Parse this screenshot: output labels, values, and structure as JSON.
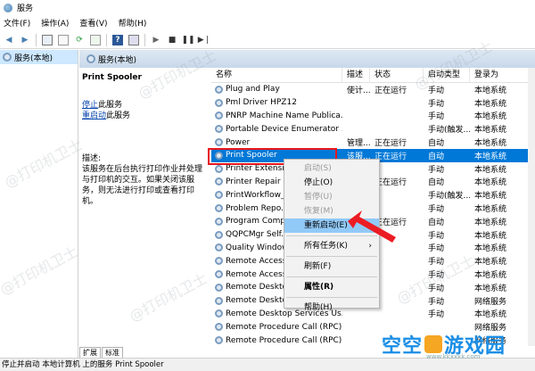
{
  "window": {
    "title": "服务"
  },
  "menu": [
    "文件(F)",
    "操作(A)",
    "查看(V)",
    "帮助(H)"
  ],
  "tree": {
    "root_label": "服务(本地)"
  },
  "pane": {
    "header": "服务(本地)"
  },
  "detail": {
    "service_name": "Print Spooler",
    "stop_link": "停止",
    "stop_suffix": "此服务",
    "restart_link": "重启动",
    "restart_suffix": "此服务",
    "description_label": "描述:",
    "description": "该服务在后台执行打印作业并处理与打印机的交互。如果关闭该服务，则无法进行打印或查看打印机。"
  },
  "columns": [
    "名称",
    "描述",
    "状态",
    "启动类型",
    "登录为"
  ],
  "rows": [
    {
      "name": "Plug and Play",
      "desc": "使计...",
      "status": "正在运行",
      "startup": "手动",
      "logon": "本地系统"
    },
    {
      "name": "Pml Driver HPZ12",
      "desc": "",
      "status": "",
      "startup": "手动",
      "logon": "本地系统"
    },
    {
      "name": "PNRP Machine Name Publica...",
      "desc": "",
      "status": "",
      "startup": "手动",
      "logon": "本地系统"
    },
    {
      "name": "Portable Device Enumerator ...",
      "desc": "",
      "status": "",
      "startup": "手动(触发...",
      "logon": "本地系统"
    },
    {
      "name": "Power",
      "desc": "管理...",
      "status": "正在运行",
      "startup": "自动",
      "logon": "本地系统"
    },
    {
      "name": "Print Spooler",
      "desc": "该服...",
      "status": "正在运行",
      "startup": "自动",
      "logon": "本地系统",
      "selected": true
    },
    {
      "name": "Printer Extensio...",
      "desc": "",
      "status": "",
      "startup": "手动",
      "logon": "本地系统"
    },
    {
      "name": "Printer Repair ...",
      "desc": "",
      "status": "正在运行",
      "startup": "自动",
      "logon": "本地系统"
    },
    {
      "name": "PrintWorkflow_...",
      "desc": "",
      "status": "",
      "startup": "手动(触发...",
      "logon": "本地系统"
    },
    {
      "name": "Problem Repo...",
      "desc": "",
      "status": "",
      "startup": "手动",
      "logon": "本地系统"
    },
    {
      "name": "Program Comp...",
      "desc": "",
      "status": "正在运行",
      "startup": "自动",
      "logon": "本地系统"
    },
    {
      "name": "QQPCMgr Self...",
      "desc": "",
      "status": "",
      "startup": "手动",
      "logon": "本地系统"
    },
    {
      "name": "Quality Window...",
      "desc": "",
      "status": "",
      "startup": "手动",
      "logon": "本地系统"
    },
    {
      "name": "Remote Access...",
      "desc": "",
      "status": "",
      "startup": "手动",
      "logon": "本地系统"
    },
    {
      "name": "Remote Access...",
      "desc": "",
      "status": "",
      "startup": "手动",
      "logon": "本地系统"
    },
    {
      "name": "Remote Deskto...",
      "desc": "",
      "status": "",
      "startup": "手动",
      "logon": "本地系统"
    },
    {
      "name": "Remote Deskto...",
      "desc": "",
      "status": "",
      "startup": "手动",
      "logon": "网络服务"
    },
    {
      "name": "Remote Desktop Services Us...",
      "desc": "",
      "status": "",
      "startup": "手动",
      "logon": "本地系统"
    },
    {
      "name": "Remote Procedure Call (RPC)",
      "desc": "",
      "status": "",
      "startup": "",
      "logon": "网络服务"
    },
    {
      "name": "Remote Procedure Call (RPC)",
      "desc": "",
      "status": "",
      "startup": "",
      "logon": "网络服务"
    }
  ],
  "context_menu": {
    "start": "启动(S)",
    "stop": "停止(O)",
    "pause": "暂停(U)",
    "resume": "恢复(M)",
    "restart": "重新启动(E)",
    "all_tasks": "所有任务(K)",
    "refresh": "刷新(F)",
    "properties": "属性(R)",
    "help": "帮助(H)"
  },
  "tabs": [
    "扩展",
    "标准"
  ],
  "status_bar": "停止并启动 本地计算机 上的服务 Print Spooler",
  "brand": {
    "name_part1": "空空",
    "name_part2": "游戏园",
    "url": "www.kkxxkk.com"
  },
  "watermark": "@打印机卫士",
  "colors": {
    "selection": "#0078d7",
    "highlight_box": "#e8161e",
    "menu_active": "#91c9f7"
  }
}
